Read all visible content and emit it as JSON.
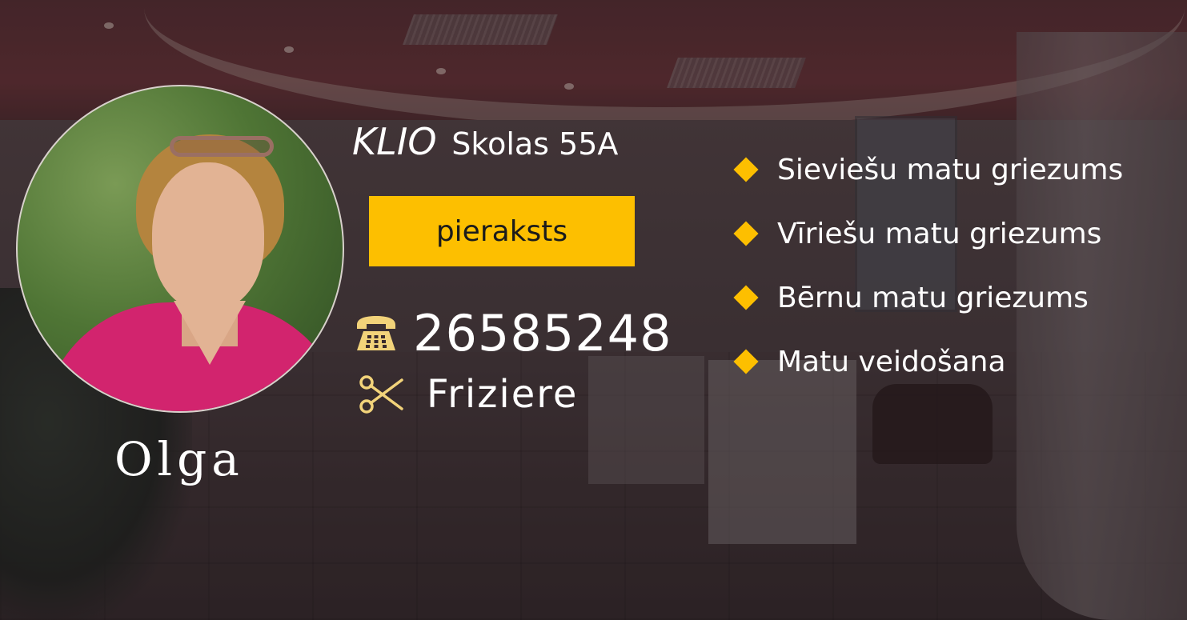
{
  "colors": {
    "accent": "#fdbf00",
    "text": "#ffffff",
    "button_text": "#1b1b1b"
  },
  "profile": {
    "name": "Olga"
  },
  "salon": {
    "brand": "KLIO",
    "address": "Skolas 55A"
  },
  "booking": {
    "button_label": "pieraksts"
  },
  "contact": {
    "phone_icon": "telephone-icon",
    "phone": "26585248"
  },
  "role": {
    "icon": "scissors-icon",
    "label": "Friziere"
  },
  "services": {
    "bullet_icon": "diamond-bullet-icon",
    "items": [
      {
        "label": "Sieviešu matu griezums"
      },
      {
        "label": "Vīriešu matu griezums"
      },
      {
        "label": "Bērnu matu griezums"
      },
      {
        "label": "Matu veidošana"
      }
    ]
  }
}
